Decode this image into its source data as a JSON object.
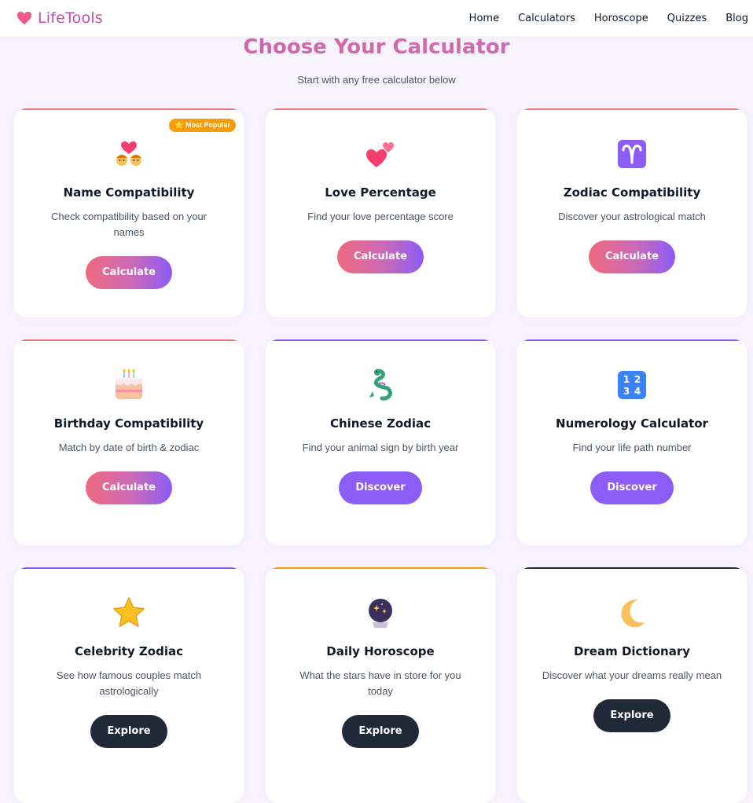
{
  "header": {
    "logo_text": "LifeTools",
    "nav": [
      "Home",
      "Calculators",
      "Horoscope",
      "Quizzes",
      "Blog"
    ]
  },
  "hero": {
    "title": "Choose Your Calculator",
    "subtitle": "Start with any free calculator below"
  },
  "cards": [
    {
      "title": "Name Compatibility",
      "description": "Check compatibility based on your names",
      "button": "Calculate",
      "badge": "⭐ Most Popular",
      "icon": "couple-heart-icon"
    },
    {
      "title": "Love Percentage",
      "description": "Find your love percentage score",
      "button": "Calculate",
      "icon": "two-hearts-icon"
    },
    {
      "title": "Zodiac Compatibility",
      "description": "Discover your astrological match",
      "button": "Calculate",
      "icon": "aries-icon"
    },
    {
      "title": "Birthday Compatibility",
      "description": "Match by date of birth & zodiac",
      "button": "Calculate",
      "icon": "birthday-cake-icon"
    },
    {
      "title": "Chinese Zodiac",
      "description": "Find your animal sign by birth year",
      "button": "Discover",
      "icon": "dragon-icon"
    },
    {
      "title": "Numerology Calculator",
      "description": "Find your life path number",
      "button": "Discover",
      "icon": "numbers-icon"
    },
    {
      "title": "Celebrity Zodiac",
      "description": "See how famous couples match astrologically",
      "button": "Explore",
      "icon": "star-icon"
    },
    {
      "title": "Daily Horoscope",
      "description": "What the stars have in store for you today",
      "button": "Explore",
      "icon": "crystal-ball-icon"
    },
    {
      "title": "Dream Dictionary",
      "description": "Discover what your dreams really mean",
      "button": "Explore",
      "icon": "moon-icon"
    }
  ],
  "numerology_digits": [
    "1",
    "2",
    "3",
    "4"
  ]
}
